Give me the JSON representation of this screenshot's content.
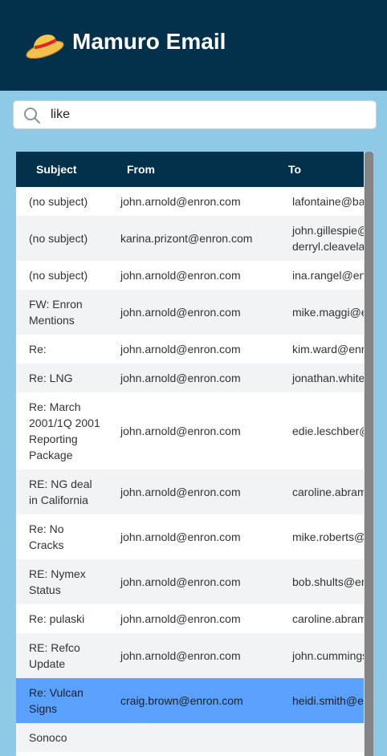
{
  "app": {
    "title": "Mamuro Email",
    "logo_icon": "straw-hat-icon"
  },
  "search": {
    "value": "like",
    "placeholder": ""
  },
  "table": {
    "columns": [
      "Subject",
      "From",
      "To"
    ],
    "rows": [
      {
        "subject": "(no subject)",
        "from": "john.arnold@enron.com",
        "to": [
          "lafontaine@ba"
        ]
      },
      {
        "subject": "(no subject)",
        "from": "karina.prizont@enron.com",
        "to": [
          "john.gillespie@",
          "derryl.cleavela"
        ]
      },
      {
        "subject": "(no subject)",
        "from": "john.arnold@enron.com",
        "to": [
          "ina.rangel@en"
        ]
      },
      {
        "subject": "FW: Enron Mentions",
        "from": "john.arnold@enron.com",
        "to": [
          "mike.maggi@e"
        ]
      },
      {
        "subject": "Re:",
        "from": "john.arnold@enron.com",
        "to": [
          "kim.ward@enr"
        ]
      },
      {
        "subject": "Re: LNG",
        "from": "john.arnold@enron.com",
        "to": [
          "jonathan.white"
        ]
      },
      {
        "subject": "Re: March 2001/1Q 2001 Reporting Package",
        "from": "john.arnold@enron.com",
        "to": [
          "edie.leschber@"
        ]
      },
      {
        "subject": "RE: NG deal in California",
        "from": "john.arnold@enron.com",
        "to": [
          "caroline.abram"
        ]
      },
      {
        "subject": "Re: No Cracks",
        "from": "john.arnold@enron.com",
        "to": [
          "mike.roberts@"
        ]
      },
      {
        "subject": "RE: Nymex Status",
        "from": "john.arnold@enron.com",
        "to": [
          "bob.shults@er"
        ]
      },
      {
        "subject": "Re: pulaski",
        "from": "john.arnold@enron.com",
        "to": [
          "caroline.abram"
        ]
      },
      {
        "subject": "RE: Refco Update",
        "from": "john.arnold@enron.com",
        "to": [
          "john.cummings"
        ]
      },
      {
        "subject": "Re: Vulcan Signs",
        "from": "craig.brown@enron.com",
        "to": [
          "heidi.smith@e"
        ],
        "selected": true
      },
      {
        "subject": "Sonoco",
        "from": "",
        "to": [
          ""
        ]
      }
    ]
  },
  "colors": {
    "header_bg": "#03304a",
    "page_bg": "#8ec9e6",
    "row_alt": "#f2f3f5",
    "selected_row": "#59a1fd",
    "scrollbar_thumb": "#848484"
  }
}
